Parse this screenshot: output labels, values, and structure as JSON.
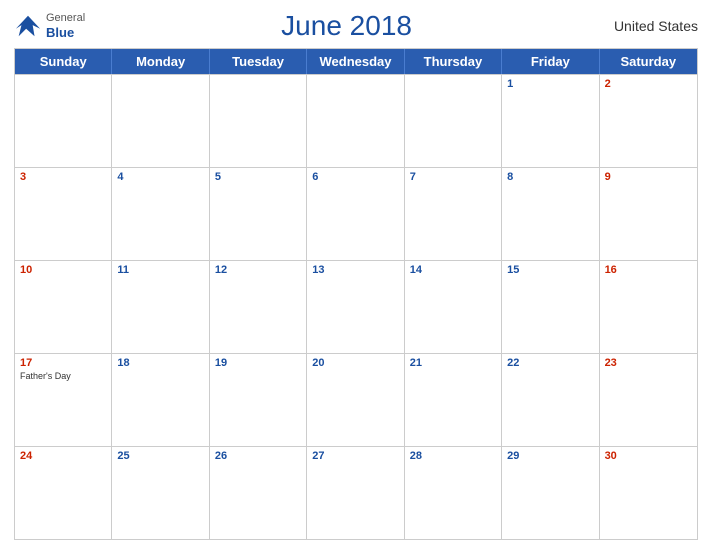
{
  "header": {
    "logo_general": "General",
    "logo_blue": "Blue",
    "title": "June 2018",
    "country": "United States"
  },
  "days": [
    "Sunday",
    "Monday",
    "Tuesday",
    "Wednesday",
    "Thursday",
    "Friday",
    "Saturday"
  ],
  "weeks": [
    [
      {
        "num": "",
        "event": ""
      },
      {
        "num": "",
        "event": ""
      },
      {
        "num": "",
        "event": ""
      },
      {
        "num": "",
        "event": ""
      },
      {
        "num": "",
        "event": ""
      },
      {
        "num": "1",
        "event": "",
        "type": "friday"
      },
      {
        "num": "2",
        "event": "",
        "type": "saturday"
      }
    ],
    [
      {
        "num": "3",
        "event": "",
        "type": "sunday"
      },
      {
        "num": "4",
        "event": ""
      },
      {
        "num": "5",
        "event": ""
      },
      {
        "num": "6",
        "event": ""
      },
      {
        "num": "7",
        "event": ""
      },
      {
        "num": "8",
        "event": ""
      },
      {
        "num": "9",
        "event": "",
        "type": "saturday"
      }
    ],
    [
      {
        "num": "10",
        "event": "",
        "type": "sunday"
      },
      {
        "num": "11",
        "event": ""
      },
      {
        "num": "12",
        "event": ""
      },
      {
        "num": "13",
        "event": ""
      },
      {
        "num": "14",
        "event": ""
      },
      {
        "num": "15",
        "event": ""
      },
      {
        "num": "16",
        "event": "",
        "type": "saturday"
      }
    ],
    [
      {
        "num": "17",
        "event": "Father's Day",
        "type": "sunday"
      },
      {
        "num": "18",
        "event": ""
      },
      {
        "num": "19",
        "event": ""
      },
      {
        "num": "20",
        "event": ""
      },
      {
        "num": "21",
        "event": ""
      },
      {
        "num": "22",
        "event": ""
      },
      {
        "num": "23",
        "event": "",
        "type": "saturday"
      }
    ],
    [
      {
        "num": "24",
        "event": "",
        "type": "sunday"
      },
      {
        "num": "25",
        "event": ""
      },
      {
        "num": "26",
        "event": ""
      },
      {
        "num": "27",
        "event": ""
      },
      {
        "num": "28",
        "event": ""
      },
      {
        "num": "29",
        "event": ""
      },
      {
        "num": "30",
        "event": "",
        "type": "saturday"
      }
    ]
  ]
}
